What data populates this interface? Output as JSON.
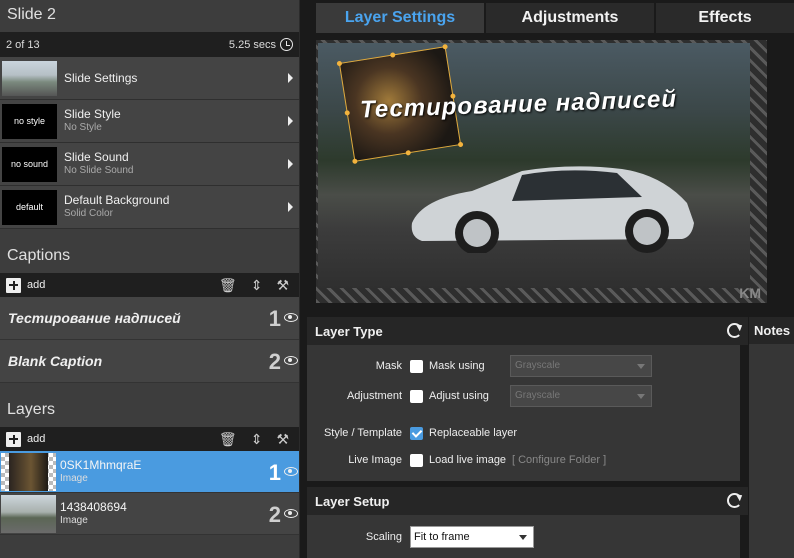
{
  "slide": {
    "title": "Slide 2",
    "position": "2 of 13",
    "duration": "5.25 secs",
    "settings": [
      {
        "thumb": "",
        "label": "Slide Settings",
        "sub": ""
      },
      {
        "thumb": "no style",
        "label": "Slide Style",
        "sub": "No Style"
      },
      {
        "thumb": "no sound",
        "label": "Slide Sound",
        "sub": "No Slide Sound"
      },
      {
        "thumb": "default",
        "label": "Default Background",
        "sub": "Solid Color"
      }
    ]
  },
  "captions": {
    "heading": "Captions",
    "add_label": "add",
    "items": [
      {
        "text": "Тестирование надписей",
        "index": "1"
      },
      {
        "text": "Blank Caption",
        "index": "2"
      }
    ]
  },
  "layers": {
    "heading": "Layers",
    "add_label": "add",
    "items": [
      {
        "name": "0SK1MhmqraE",
        "type": "Image",
        "index": "1",
        "selected": true
      },
      {
        "name": "1438408694",
        "type": "Image",
        "index": "2",
        "selected": false
      }
    ]
  },
  "tabs": [
    "Layer Settings",
    "Adjustments",
    "Effects"
  ],
  "preview": {
    "caption": "Тестирование надписей",
    "watermark": "KM"
  },
  "layer_type": {
    "heading": "Layer Type",
    "mask_label": "Mask",
    "mask_check": "Mask using",
    "mask_select": "Grayscale",
    "adjust_label": "Adjustment",
    "adjust_check": "Adjust using",
    "adjust_select": "Grayscale",
    "style_label": "Style / Template",
    "style_check": "Replaceable layer",
    "live_label": "Live Image",
    "live_check": "Load live image",
    "configure": "[ Configure Folder ]"
  },
  "layer_setup": {
    "heading": "Layer Setup",
    "scaling_label": "Scaling",
    "scaling_value": "Fit to frame"
  },
  "notes": {
    "heading": "Notes"
  },
  "colors": {
    "accent": "#4a9be0",
    "handle": "#f3b33d"
  }
}
